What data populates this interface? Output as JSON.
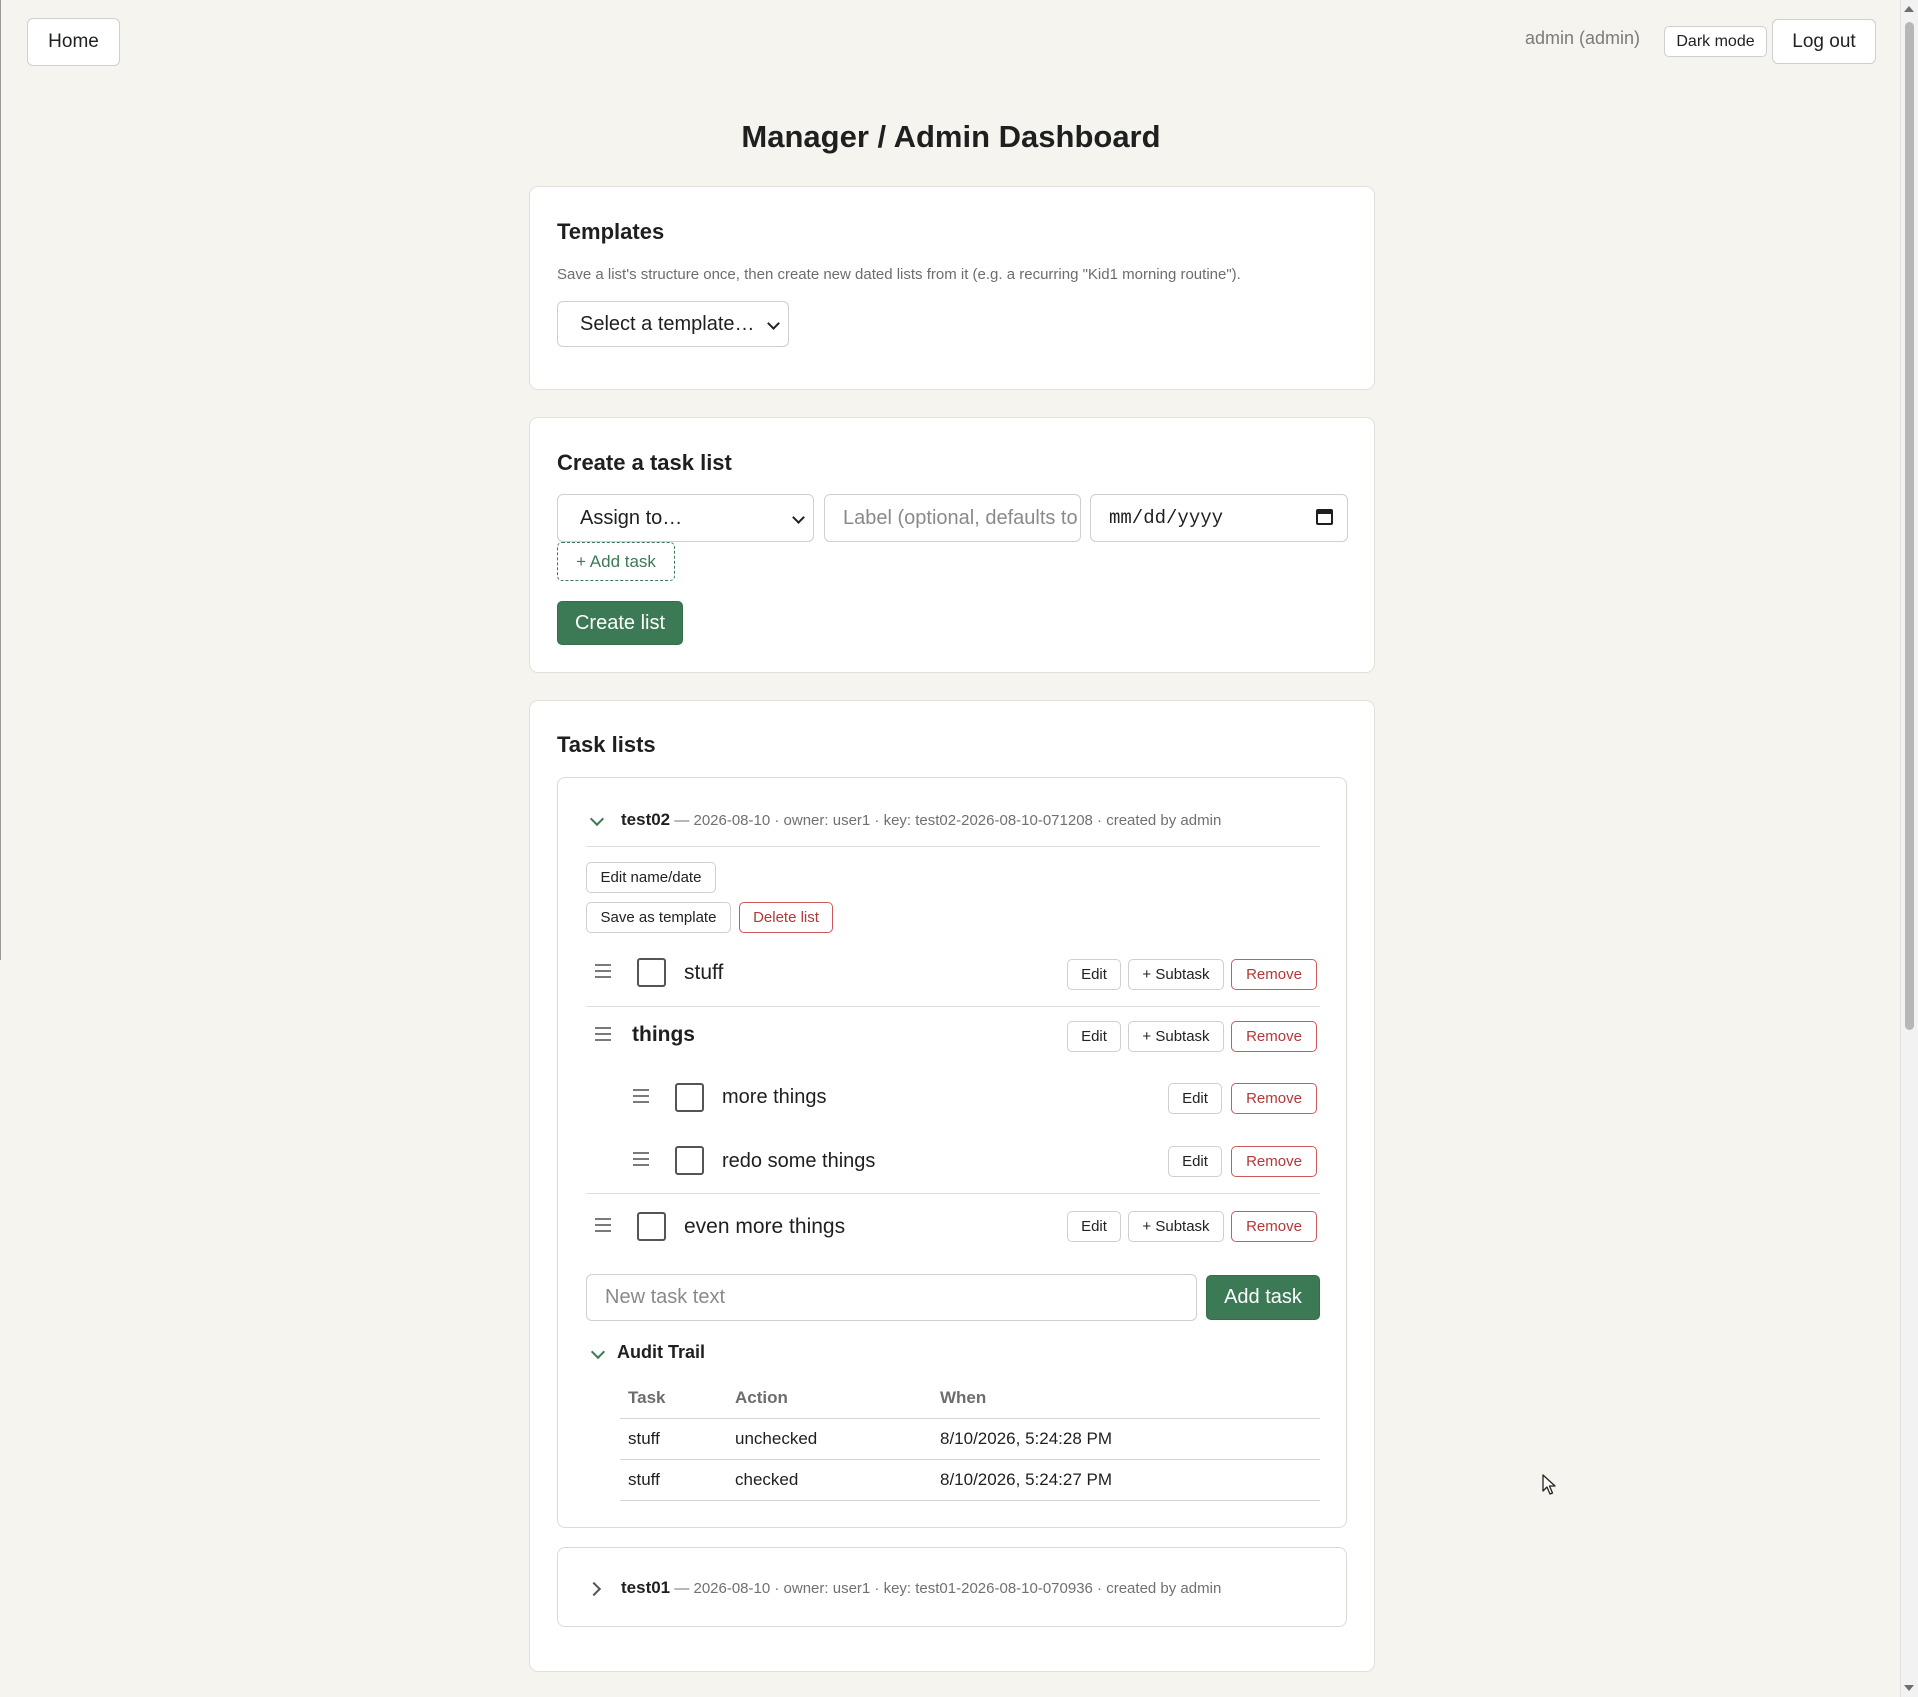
{
  "topbar": {
    "home_label": "Home",
    "user_label": "admin (admin)",
    "dark_mode_label": "Dark mode",
    "logout_label": "Log out"
  },
  "page_title": "Manager / Admin Dashboard",
  "templates": {
    "heading": "Templates",
    "description": "Save a list's structure once, then create new dated lists from it (e.g. a recurring \"Kid1 morning routine\").",
    "select_value": "Select a template…"
  },
  "create": {
    "heading": "Create a task list",
    "assign_value": "Assign to…",
    "label_placeholder": "Label (optional, defaults to",
    "date_placeholder": "mm/dd/yyyy",
    "add_task_label": "+ Add task",
    "create_label": "Create list"
  },
  "task_lists": {
    "heading": "Task lists",
    "lists": [
      {
        "name": "test02",
        "meta": "— 2026-08-10 · owner: user1 · key: test02-2026-08-10-071208 · created by admin",
        "expanded": true,
        "edit_label": "Edit name/date",
        "save_template_label": "Save as template",
        "delete_label": "Delete list",
        "tasks": [
          {
            "text": "stuff",
            "type": "task",
            "checked": false
          },
          {
            "text": "things",
            "type": "group"
          },
          {
            "text": "more things",
            "type": "subtask",
            "checked": false
          },
          {
            "text": "redo some things",
            "type": "subtask",
            "checked": false
          },
          {
            "text": "even more things",
            "type": "task",
            "checked": false
          }
        ],
        "row_actions": {
          "edit": "Edit",
          "subtask": "+ Subtask",
          "remove": "Remove"
        },
        "new_task_placeholder": "New task text",
        "add_task_label": "Add task",
        "audit": {
          "title": "Audit Trail",
          "columns": [
            "Task",
            "Action",
            "When"
          ],
          "rows": [
            [
              "stuff",
              "unchecked",
              "8/10/2026, 5:24:28 PM"
            ],
            [
              "stuff",
              "checked",
              "8/10/2026, 5:24:27 PM"
            ]
          ]
        }
      },
      {
        "name": "test01",
        "meta": "— 2026-08-10 · owner: user1 · key: test01-2026-08-10-070936 · created by admin",
        "expanded": false
      }
    ]
  },
  "colors": {
    "accent": "#3c7a55",
    "danger": "#b53737",
    "background": "#f6f4ef"
  }
}
